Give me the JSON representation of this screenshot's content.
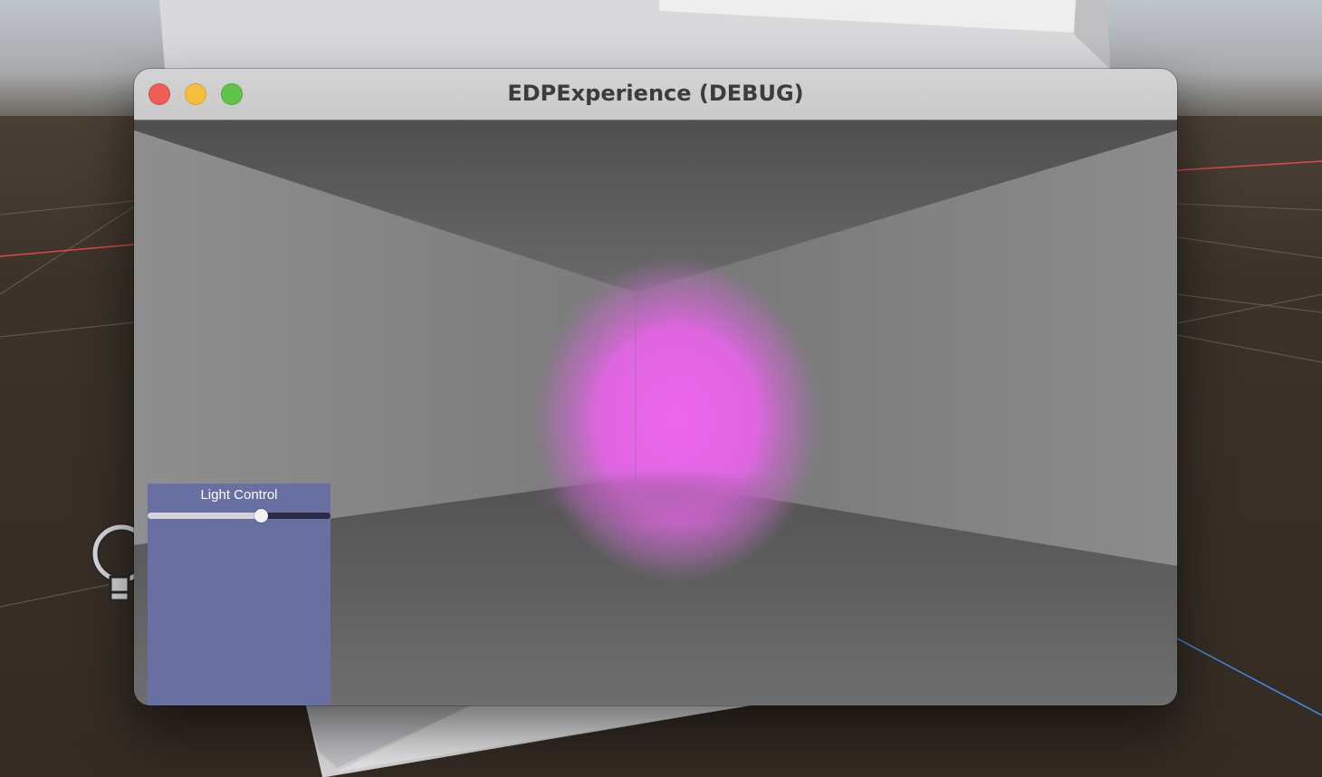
{
  "window": {
    "title": "EDPExperience (DEBUG)"
  },
  "light_panel": {
    "title": "Light Control",
    "slider_value": 0.62
  },
  "colors": {
    "editor_floor": "#3a3129",
    "editor_sky": "#aeb3b9",
    "panel_bg": "#6770a0",
    "light_glow": "#ee66ee",
    "x_axis": "#e0464a",
    "z_axis": "#3f8ff0"
  },
  "icons": {
    "light_gizmo": "lightbulb-icon",
    "close": "close-icon",
    "minimize": "minimize-icon",
    "maximize": "maximize-icon"
  }
}
